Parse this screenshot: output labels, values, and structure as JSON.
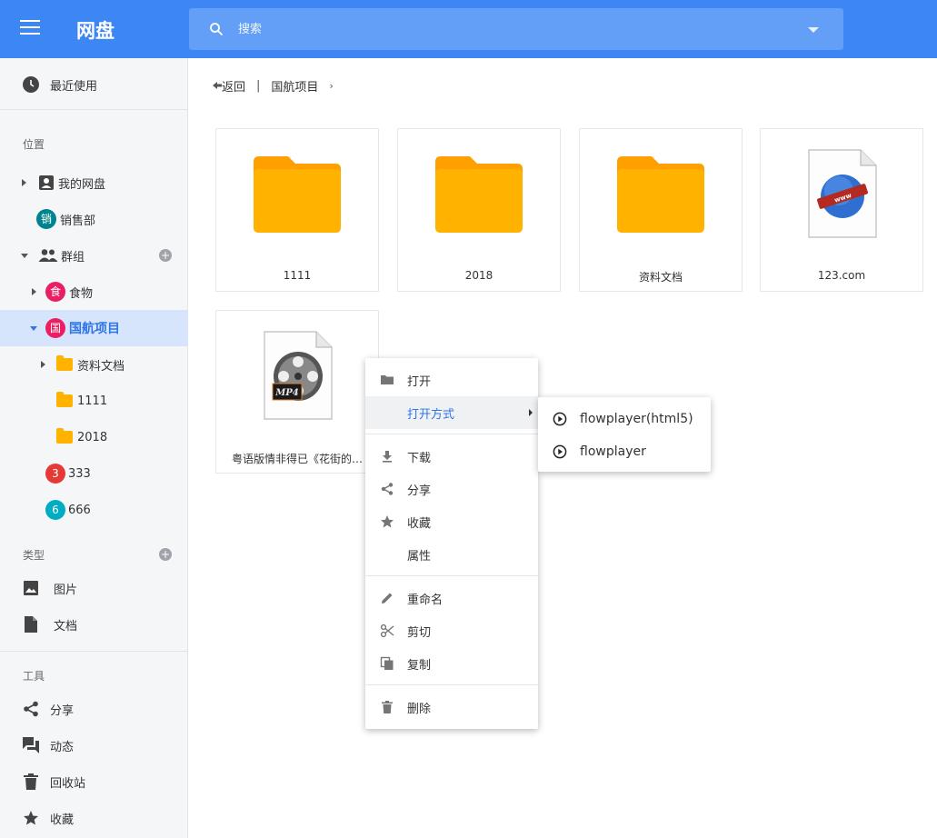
{
  "header": {
    "title": "网盘",
    "search_placeholder": "搜索",
    "search_value": ""
  },
  "sidebar": {
    "recent_label": "最近使用",
    "location_section": "位置",
    "my_disk_label": "我的网盘",
    "sales_avatar": "销",
    "sales_label": "销售部",
    "groups_label": "群组",
    "food_avatar": "食",
    "food_label": "食物",
    "project_avatar": "国",
    "project_label": "国航项目",
    "folder_docs_label": "资料文档",
    "folder_1111_label": "1111",
    "folder_2018_label": "2018",
    "g333_avatar": "3",
    "g333_label": "333",
    "g666_avatar": "6",
    "g666_label": "666",
    "type_section": "类型",
    "images_label": "图片",
    "docs_label": "文档",
    "tools_section": "工具",
    "share_label": "分享",
    "activity_label": "动态",
    "recycle_label": "回收站",
    "favorites_label": "收藏",
    "colors": {
      "sales": "#00838f",
      "food": "#e91e63",
      "project": "#e91e63",
      "g333": "#e53935",
      "g666": "#00acc1"
    }
  },
  "breadcrumb": {
    "back_label": "返回",
    "separator": "|",
    "current": "国航项目",
    "chevron": "›"
  },
  "files": [
    {
      "name": "1111",
      "kind": "folder"
    },
    {
      "name": "2018",
      "kind": "folder"
    },
    {
      "name": "资料文档",
      "kind": "folder"
    },
    {
      "name": "123.com",
      "kind": "web-file"
    },
    {
      "name": "粤语版情非得已《花街的…",
      "kind": "mp4-file"
    }
  ],
  "context_menu": {
    "open": "打开",
    "open_with": "打开方式",
    "download": "下载",
    "share": "分享",
    "favorite": "收藏",
    "properties": "属性",
    "rename": "重命名",
    "cut": "剪切",
    "copy": "复制",
    "delete": "删除"
  },
  "submenu": {
    "item1": "flowplayer(html5)",
    "item2": "flowplayer"
  },
  "theme": {
    "header_bg": "#3d87f5",
    "accent": "#2f74e8",
    "folder": "#ffb300"
  }
}
